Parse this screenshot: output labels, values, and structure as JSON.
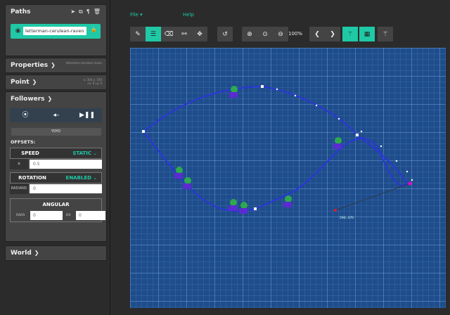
{
  "sidebar": {
    "paths_title": "Paths",
    "path_name": "letterman-cerulean-raven",
    "properties_title": "Properties",
    "properties_sub": "letterman-cerulean-raven",
    "point_title": "Point",
    "point_sub_1": "x: 300 y: 100",
    "point_sub_2": "cx: 0 cy: 0",
    "followers_title": "Followers",
    "yoyo_label": "YOYO",
    "offsets_label": "OFFSETS:",
    "speed_label": "SPEED",
    "speed_value": "STATIC",
    "speed_input": "0.5",
    "rotation_label": "ROTATION",
    "rotation_value": "ENABLED",
    "radians_label": "RADIANS",
    "radians_input": "0",
    "angular_label": "ANGULAR",
    "rads_label": "RADS",
    "rads_input": "0",
    "dx_label": "DX",
    "dx_input": "0",
    "world_title": "World"
  },
  "menu": {
    "file": "File",
    "help": "Help"
  },
  "toolbar": {
    "zoom_level": "100%"
  },
  "canvas": {
    "coords": "590, 470"
  },
  "icons": {
    "edit": "pencil-icon",
    "adjust": "sliders-icon",
    "erase": "eraser-icon",
    "link": "link-icon",
    "move": "move-icon",
    "undo": "undo-icon",
    "zoom_in": "zoom-in-icon",
    "zoom_fit": "zoom-fit-icon",
    "zoom_out": "zoom-out-icon",
    "prev": "chevron-left-icon",
    "next": "chevron-right-icon",
    "magic_on": "magic-wand-icon",
    "grid": "grid-icon",
    "magic_off": "magic-wand-off-icon"
  },
  "colors": {
    "accent": "#1fc9a6",
    "canvas_bg": "#1f4d8c",
    "path_line": "#2a36d9"
  }
}
